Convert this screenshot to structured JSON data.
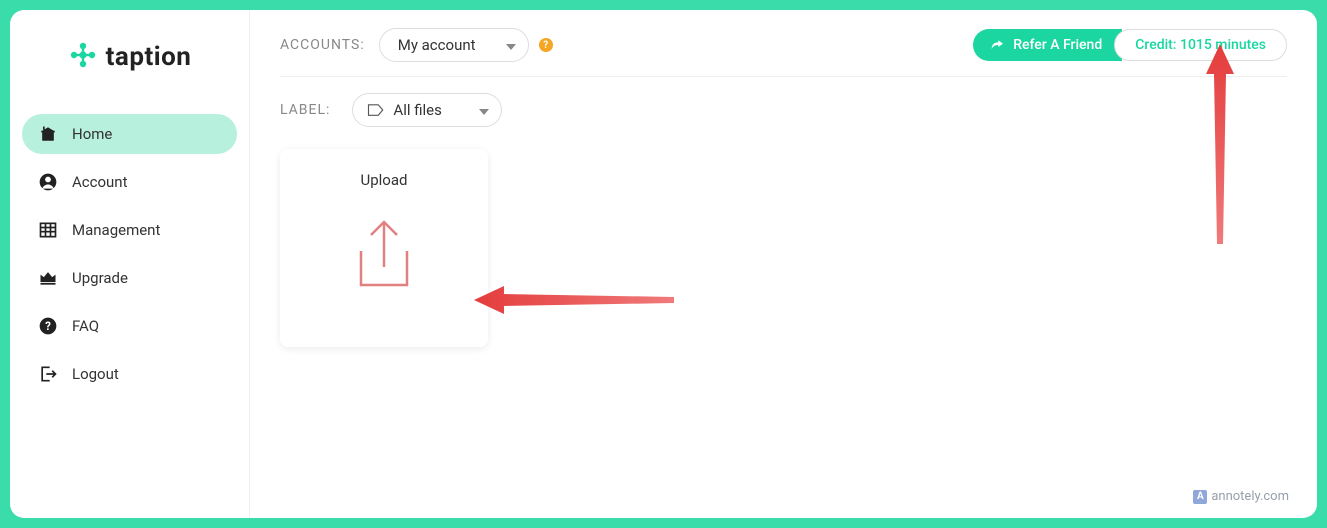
{
  "brand": {
    "name": "taption"
  },
  "sidebar": {
    "items": [
      {
        "label": "Home"
      },
      {
        "label": "Account"
      },
      {
        "label": "Management"
      },
      {
        "label": "Upgrade"
      },
      {
        "label": "FAQ"
      },
      {
        "label": "Logout"
      }
    ]
  },
  "topbar": {
    "accounts_label": "ACCOUNTS:",
    "account_selected": "My account",
    "refer_label": "Refer A Friend",
    "credit_label": "Credit: 1015 minutes"
  },
  "filter": {
    "label_label": "LABEL:",
    "label_selected": "All files"
  },
  "upload": {
    "title": "Upload"
  },
  "watermark": {
    "text": "annotely.com"
  }
}
